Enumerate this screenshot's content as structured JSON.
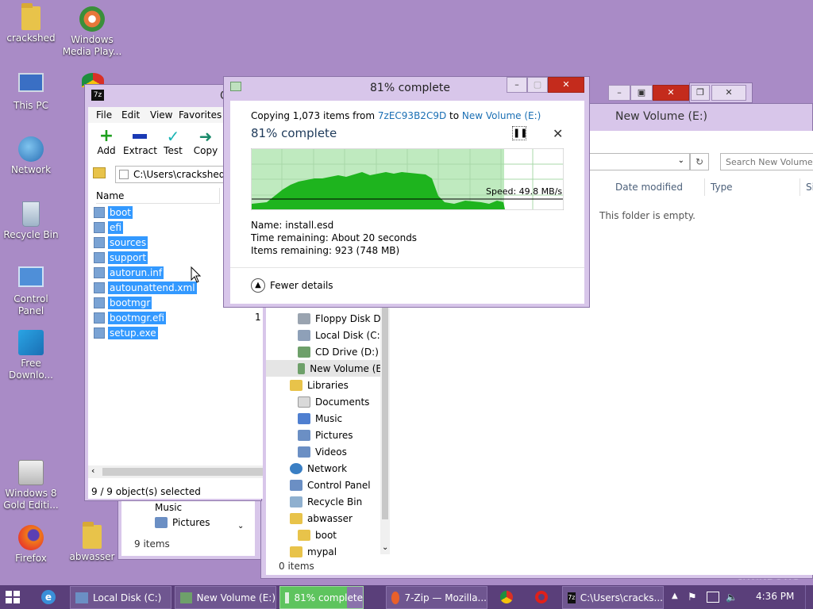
{
  "desktop": {
    "icons": [
      {
        "label": "crackshed"
      },
      {
        "label": "Windows Media Play..."
      },
      {
        "label": "This PC"
      },
      {
        "label": "Network"
      },
      {
        "label": "Recycle Bin"
      },
      {
        "label": "Control Panel"
      },
      {
        "label": "Free Downlo..."
      },
      {
        "label": "Windows 8 Gold Editi..."
      },
      {
        "label": "Firefox"
      },
      {
        "label": "abwasser"
      }
    ]
  },
  "zip": {
    "menu": [
      "File",
      "Edit",
      "View",
      "Favorites"
    ],
    "toolbar": [
      "Add",
      "Extract",
      "Test",
      "Copy"
    ],
    "path": "C:\\Users\\crackshed\\D",
    "column": "Name",
    "files": [
      "boot",
      "efi",
      "sources",
      "support",
      "autorun.inf",
      "autounattend.xml",
      "bootmgr",
      "bootmgr.efi",
      "setup.exe"
    ],
    "status": "9 / 9 object(s) selected",
    "partial_title": "C",
    "partial_col": "1"
  },
  "copy": {
    "title": "81% complete",
    "line_prefix": "Copying 1,073 items from ",
    "source": "7zEC93B2C9D",
    "to": " to ",
    "dest": "New Volume (E:)",
    "heading": "81% complete",
    "progress": 0.81,
    "speed": "Speed: 49.8 MB/s",
    "name_line": "Name:  install.esd",
    "time_line": "Time remaining:  About 20 seconds",
    "items_line": "Items remaining:  923 (748 MB)",
    "fewer": "Fewer details"
  },
  "explorer": {
    "title": "New Volume (E:)",
    "search_placeholder": "Search New Volume",
    "columns": [
      "Date modified",
      "Type",
      "Si"
    ],
    "empty": "This folder is empty.",
    "nav": [
      {
        "label": "Floppy Disk Dri",
        "color": "#9aa4b0"
      },
      {
        "label": "Local Disk (C:)",
        "color": "#8ea0b8"
      },
      {
        "label": "CD Drive (D:) W",
        "color": "#6ea06a"
      },
      {
        "label": "New Volume (E",
        "color": "#6ea06a"
      },
      {
        "label": "Libraries",
        "color": "#e8c34a"
      },
      {
        "label": "Documents",
        "color": "#d9d9d9"
      },
      {
        "label": "Music",
        "color": "#4f7fd0"
      },
      {
        "label": "Pictures",
        "color": "#6b8fc4"
      },
      {
        "label": "Videos",
        "color": "#6b8fc4"
      },
      {
        "label": "Network",
        "color": "#3a7fc4"
      },
      {
        "label": "Control Panel",
        "color": "#6b8fc4"
      },
      {
        "label": "Recycle Bin",
        "color": "#8fb0cf"
      },
      {
        "label": "abwasser",
        "color": "#e8c34a"
      },
      {
        "label": "boot",
        "color": "#e8c34a"
      },
      {
        "label": "mypal",
        "color": "#e8c34a"
      }
    ],
    "status": "0 items"
  },
  "explorer2": {
    "nav": [
      "Music",
      "Pictures"
    ],
    "status": "9 items"
  },
  "taskbar": {
    "items": [
      "Local Disk (C:)",
      "New Volume (E:)",
      "81% complete",
      "7-Zip — Mozilla...",
      "C:\\Users\\cracks..."
    ],
    "time": "4:36 PM"
  },
  "watermark": "c.WINDOWS"
}
